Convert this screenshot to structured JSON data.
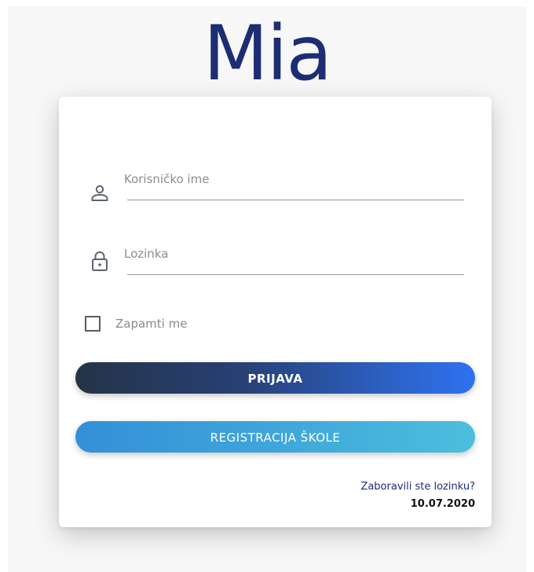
{
  "app": {
    "logo_text": "Mia"
  },
  "form": {
    "username": {
      "label": "Korisničko ime",
      "icon": "user-icon"
    },
    "password": {
      "label": "Lozinka",
      "icon": "lock-icon"
    },
    "remember": {
      "label": "Zapamti me",
      "checked": false
    },
    "login_button_label": "PRIJAVA",
    "register_button_label": "REGISTRACIJA ŠKOLE",
    "forgot_password_link": "Zaboravili ste lozinku?",
    "date": "10.07.2020"
  },
  "colors": {
    "brand": "#1c2d74",
    "login_gradient_start": "#243447",
    "login_gradient_end": "#2e72f0",
    "register_gradient_start": "#3390d8",
    "register_gradient_end": "#4bbfdc"
  }
}
